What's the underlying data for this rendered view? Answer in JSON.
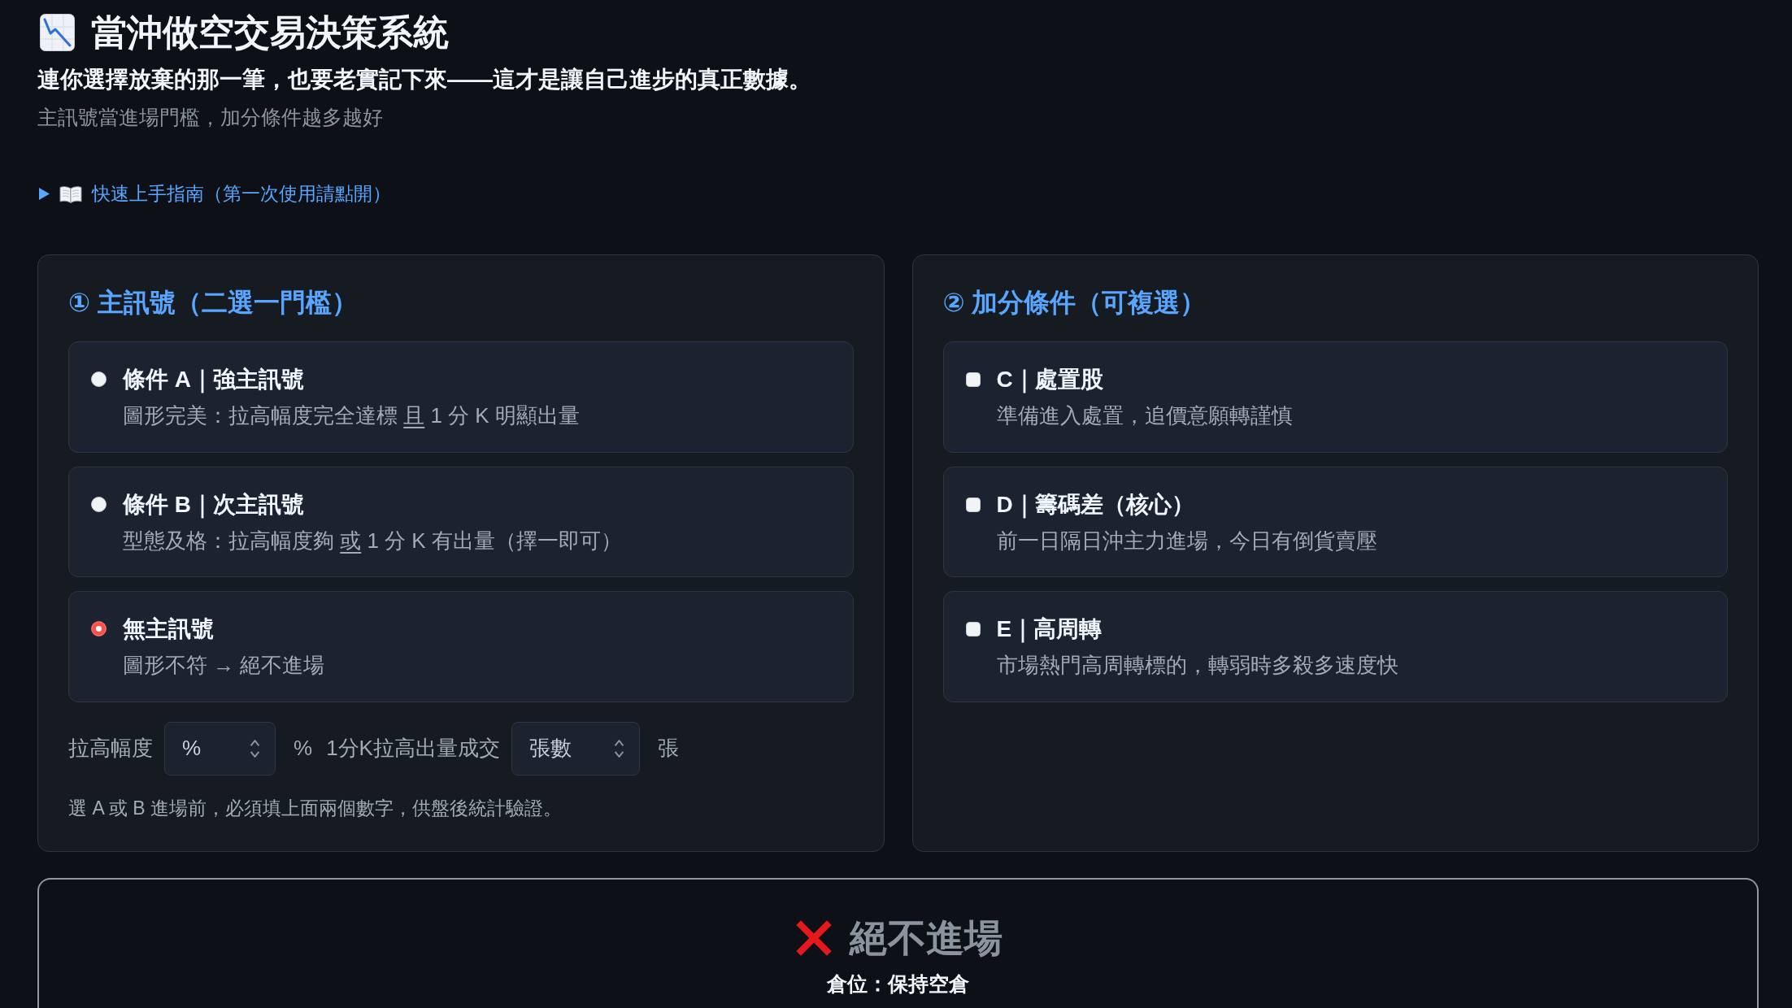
{
  "header": {
    "title": "當沖做空交易決策系統",
    "tagline": "連你選擇放棄的那一筆，也要老實記下來——這才是讓自己進步的真正數據。",
    "subtitle": "主訊號當進場門檻，加分條件越多越好"
  },
  "guide": {
    "label": "快速上手指南（第一次使用請點開）",
    "expanded": false
  },
  "main_signal": {
    "heading": "① 主訊號（二選一門檻）",
    "options": [
      {
        "title": "條件 A｜強主訊號",
        "description": [
          {
            "text": "圖形完美：拉高幅度完全達標 ",
            "underline": false
          },
          {
            "text": "且",
            "underline": true
          },
          {
            "text": " 1 分 K 明顯出量",
            "underline": false
          }
        ],
        "selected": false
      },
      {
        "title": "條件 B｜次主訊號",
        "description": [
          {
            "text": "型態及格：拉高幅度夠 ",
            "underline": false
          },
          {
            "text": "或",
            "underline": true
          },
          {
            "text": " 1 分 K 有出量（擇一即可）",
            "underline": false
          }
        ],
        "selected": false
      },
      {
        "title": "無主訊號",
        "description": [
          {
            "text": "圖形不符 → 絕不進場",
            "underline": false
          }
        ],
        "selected": true
      }
    ],
    "fields": [
      {
        "label": "拉高幅度",
        "placeholder": "%",
        "unit": "%"
      },
      {
        "label": "1分K拉高出量成交",
        "placeholder": "張數",
        "unit": "張"
      }
    ],
    "note": "選 A 或 B 進場前，必須填上面兩個數字，供盤後統計驗證。"
  },
  "bonus": {
    "heading": "② 加分條件（可複選）",
    "options": [
      {
        "title": "C｜處置股",
        "description": "準備進入處置，追價意願轉謹慎",
        "checked": false
      },
      {
        "title": "D｜籌碼差（核心）",
        "description": "前一日隔日沖主力進場，今日有倒貨賣壓",
        "checked": false
      },
      {
        "title": "E｜高周轉",
        "description": "市場熱門高周轉標的，轉弱時多殺多速度快",
        "checked": false
      }
    ]
  },
  "verdict": {
    "kind": "reject",
    "title": "絕不進場",
    "position": "倉位：保持空倉"
  }
}
